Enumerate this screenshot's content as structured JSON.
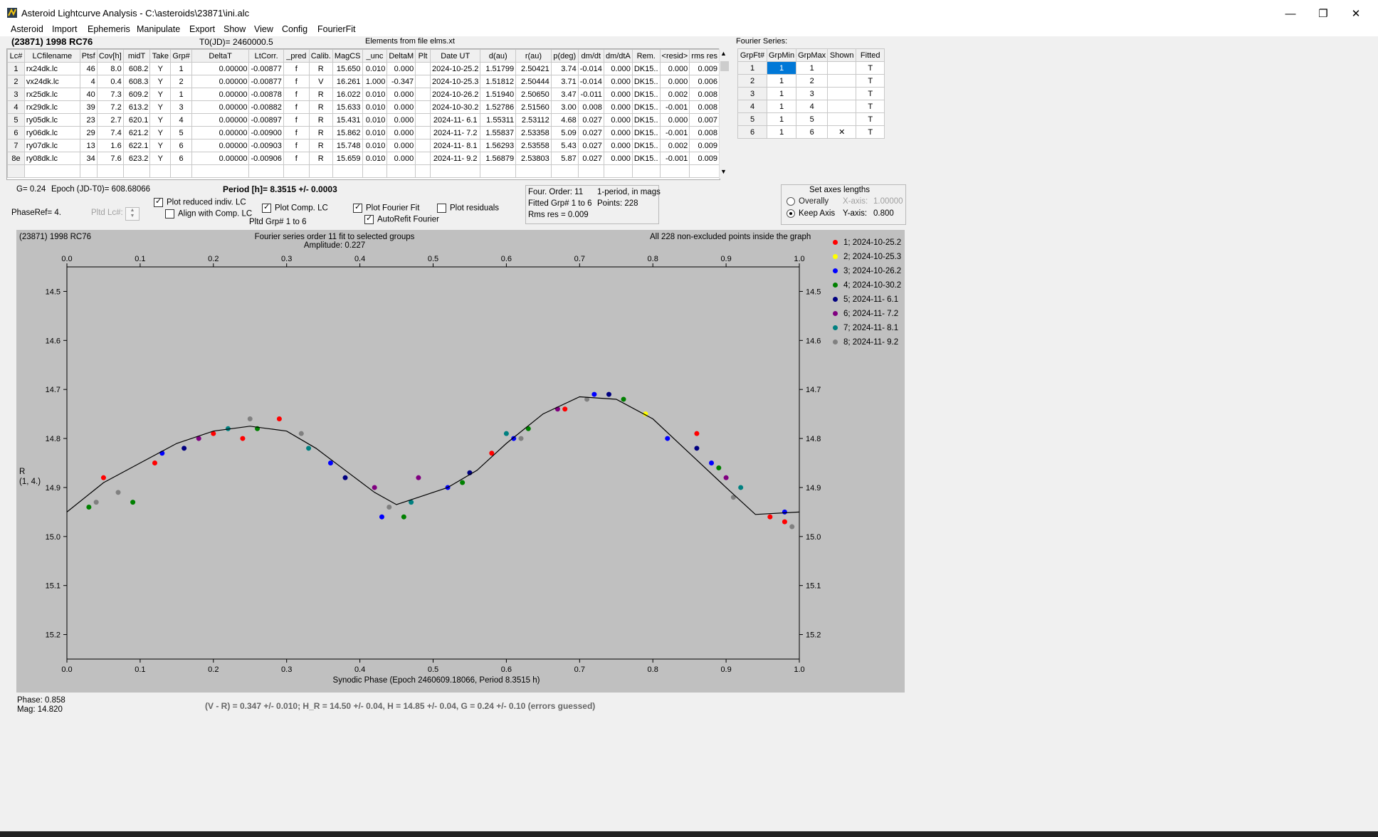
{
  "window": {
    "title": "Asteroid Lightcurve Analysis - C:\\asteroids\\23871\\ini.alc",
    "minimize": "—",
    "restore": "❐",
    "close": "✕"
  },
  "menu": [
    "Asteroid",
    "Import",
    "Ephemeris",
    "Manipulate",
    "Export",
    "Show",
    "View",
    "Config",
    "FourierFit"
  ],
  "header": {
    "asteroid_name": "(23871) 1998 RC76",
    "t0": "T0(JD)= 2460000.5",
    "elements_src": "Elements from file elms.xt",
    "fourier_series_label": "Fourier Series:"
  },
  "lc_table": {
    "columns": [
      "Lc#",
      "LCfilename",
      "Ptsf",
      "Cov[h]",
      "midT",
      "Take",
      "Grp#",
      "DeltaT",
      "LtCorr.",
      "_pred",
      "Calib.",
      "MagCS",
      "_unc",
      "DeltaM",
      "Plt",
      "Date UT",
      "d(au)",
      "r(au)",
      "p(deg)",
      "dm/dt",
      "dm/dtA",
      "Rem.",
      "<resid>",
      "rms res"
    ],
    "rows": [
      [
        "1",
        "rx24dk.lc",
        "46",
        "8.0",
        "608.2",
        "Y",
        "1",
        "0.00000",
        "-0.00877",
        "f",
        "R",
        "15.650",
        "0.010",
        "0.000",
        "",
        "2024-10-25.2",
        "1.51799",
        "2.50421",
        "3.74",
        "-0.014",
        "0.000",
        "DK15..",
        "0.000",
        "0.009"
      ],
      [
        "2",
        "vx24dk.lc",
        "4",
        "0.4",
        "608.3",
        "Y",
        "2",
        "0.00000",
        "-0.00877",
        "f",
        "V",
        "16.261",
        "1.000",
        "-0.347",
        "",
        "2024-10-25.3",
        "1.51812",
        "2.50444",
        "3.71",
        "-0.014",
        "0.000",
        "DK15..",
        "0.000",
        "0.006"
      ],
      [
        "3",
        "rx25dk.lc",
        "40",
        "7.3",
        "609.2",
        "Y",
        "1",
        "0.00000",
        "-0.00878",
        "f",
        "R",
        "16.022",
        "0.010",
        "0.000",
        "",
        "2024-10-26.2",
        "1.51940",
        "2.50650",
        "3.47",
        "-0.011",
        "0.000",
        "DK15..",
        "0.002",
        "0.008"
      ],
      [
        "4",
        "rx29dk.lc",
        "39",
        "7.2",
        "613.2",
        "Y",
        "3",
        "0.00000",
        "-0.00882",
        "f",
        "R",
        "15.633",
        "0.010",
        "0.000",
        "",
        "2024-10-30.2",
        "1.52786",
        "2.51560",
        "3.00",
        "0.008",
        "0.000",
        "DK15..",
        "-0.001",
        "0.008"
      ],
      [
        "5",
        "ry05dk.lc",
        "23",
        "2.7",
        "620.1",
        "Y",
        "4",
        "0.00000",
        "-0.00897",
        "f",
        "R",
        "15.431",
        "0.010",
        "0.000",
        "",
        "2024-11- 6.1",
        "1.55311",
        "2.53112",
        "4.68",
        "0.027",
        "0.000",
        "DK15..",
        "0.000",
        "0.007"
      ],
      [
        "6",
        "ry06dk.lc",
        "29",
        "7.4",
        "621.2",
        "Y",
        "5",
        "0.00000",
        "-0.00900",
        "f",
        "R",
        "15.862",
        "0.010",
        "0.000",
        "",
        "2024-11- 7.2",
        "1.55837",
        "2.53358",
        "5.09",
        "0.027",
        "0.000",
        "DK15..",
        "-0.001",
        "0.008"
      ],
      [
        "7",
        "ry07dk.lc",
        "13",
        "1.6",
        "622.1",
        "Y",
        "6",
        "0.00000",
        "-0.00903",
        "f",
        "R",
        "15.748",
        "0.010",
        "0.000",
        "",
        "2024-11- 8.1",
        "1.56293",
        "2.53558",
        "5.43",
        "0.027",
        "0.000",
        "DK15..",
        "0.002",
        "0.009"
      ],
      [
        "8e",
        "ry08dk.lc",
        "34",
        "7.6",
        "623.2",
        "Y",
        "6",
        "0.00000",
        "-0.00906",
        "f",
        "R",
        "15.659",
        "0.010",
        "0.000",
        "",
        "2024-11- 9.2",
        "1.56879",
        "2.53803",
        "5.87",
        "0.027",
        "0.000",
        "DK15..",
        "-0.001",
        "0.009"
      ]
    ]
  },
  "fourier_table": {
    "columns": [
      "GrpFt#",
      "GrpMin",
      "GrpMax",
      "Shown",
      "Fitted"
    ],
    "rows": [
      [
        "1",
        "1",
        "1",
        "",
        "T"
      ],
      [
        "2",
        "1",
        "2",
        "",
        "T"
      ],
      [
        "3",
        "1",
        "3",
        "",
        "T"
      ],
      [
        "4",
        "1",
        "4",
        "",
        "T"
      ],
      [
        "5",
        "1",
        "5",
        "",
        "T"
      ],
      [
        "6",
        "1",
        "6",
        "✕",
        "T"
      ]
    ]
  },
  "controls": {
    "g_value": "G= 0.24",
    "epoch": "Epoch (JD-T0)= 608.68066",
    "period": "Period [h]= 8.3515 +/- 0.0003",
    "phase_ref": "PhaseRef= 4.",
    "pltd_lc": "Pltd Lc#:",
    "plot_reduced": "Plot reduced indiv. LC",
    "align_comp": "Align with Comp. LC",
    "plot_comp": "Plot Comp. LC",
    "pltd_grp": "Pltd Grp#  1   to   6",
    "plot_fourier": "Plot Fourier Fit",
    "autorefit": "AutoRefit Fourier",
    "plot_residuals": "Plot residuals",
    "four_order": "Four. Order: 11",
    "one_period": "1-period, in mags",
    "fitted_grp": "Fitted Grp# 1 to 6",
    "points": "Points: 228",
    "rms_res": "Rms res      = 0.009",
    "set_axes": "Set axes lengths",
    "overally": "Overally",
    "keep_axis": "Keep Axis",
    "x_axis_label": "X-axis:",
    "x_axis_value": "1.00000",
    "y_axis_label": "Y-axis:",
    "y_axis_value": "0.800"
  },
  "footer": {
    "phase": "Phase:  0.858",
    "mag": "Mag:    14.820",
    "result": "(V - R) = 0.347 +/- 0.010; H_R = 14.50 +/- 0.04, H = 14.85 +/- 0.04, G = 0.24 +/- 0.10 (errors guessed)"
  },
  "chart_data": {
    "type": "scatter",
    "title_left": "(23871) 1998 RC76",
    "title_center": "Fourier series order 11 fit to selected groups",
    "amplitude": "Amplitude: 0.227",
    "title_right": "All 228 non-excluded points inside the graph",
    "xlabel": "Synodic Phase (Epoch 2460609.18066, Period 8.3515 h)",
    "ylabel": "R",
    "ylabel2": "(1, 4.)",
    "xlim": [
      0,
      1
    ],
    "ylim": [
      15.25,
      14.45
    ],
    "xticks": [
      "0.0",
      "0.1",
      "0.2",
      "0.3",
      "0.4",
      "0.5",
      "0.6",
      "0.7",
      "0.8",
      "0.9",
      "1.0"
    ],
    "yticks": [
      "14.5",
      "14.6",
      "14.7",
      "14.8",
      "14.9",
      "15.0",
      "15.1",
      "15.2"
    ],
    "fourier_curve": [
      [
        0.0,
        14.95
      ],
      [
        0.05,
        14.89
      ],
      [
        0.1,
        14.85
      ],
      [
        0.15,
        14.81
      ],
      [
        0.2,
        14.785
      ],
      [
        0.25,
        14.775
      ],
      [
        0.3,
        14.785
      ],
      [
        0.34,
        14.82
      ],
      [
        0.38,
        14.865
      ],
      [
        0.42,
        14.91
      ],
      [
        0.45,
        14.935
      ],
      [
        0.48,
        14.92
      ],
      [
        0.52,
        14.9
      ],
      [
        0.56,
        14.865
      ],
      [
        0.6,
        14.81
      ],
      [
        0.65,
        14.75
      ],
      [
        0.7,
        14.715
      ],
      [
        0.75,
        14.72
      ],
      [
        0.8,
        14.76
      ],
      [
        0.85,
        14.83
      ],
      [
        0.9,
        14.9
      ],
      [
        0.94,
        14.955
      ],
      [
        1.0,
        14.95
      ]
    ],
    "series": [
      {
        "name": "1; 2024-10-25.2",
        "color": "#ff0000",
        "points": [
          [
            0.05,
            14.88
          ],
          [
            0.12,
            14.85
          ],
          [
            0.2,
            14.79
          ],
          [
            0.24,
            14.8
          ],
          [
            0.29,
            14.76
          ],
          [
            0.58,
            14.83
          ],
          [
            0.68,
            14.74
          ],
          [
            0.86,
            14.79
          ],
          [
            0.96,
            14.96
          ],
          [
            0.98,
            14.97
          ]
        ]
      },
      {
        "name": "2; 2024-10-25.3",
        "color": "#ffff00",
        "points": [
          [
            0.79,
            14.75
          ]
        ]
      },
      {
        "name": "3; 2024-10-26.2",
        "color": "#0000ff",
        "points": [
          [
            0.13,
            14.83
          ],
          [
            0.36,
            14.85
          ],
          [
            0.43,
            14.96
          ],
          [
            0.52,
            14.9
          ],
          [
            0.61,
            14.8
          ],
          [
            0.72,
            14.71
          ],
          [
            0.82,
            14.8
          ],
          [
            0.88,
            14.85
          ],
          [
            0.98,
            14.95
          ]
        ]
      },
      {
        "name": "4; 2024-10-30.2",
        "color": "#008000",
        "points": [
          [
            0.03,
            14.94
          ],
          [
            0.09,
            14.93
          ],
          [
            0.26,
            14.78
          ],
          [
            0.46,
            14.96
          ],
          [
            0.54,
            14.89
          ],
          [
            0.63,
            14.78
          ],
          [
            0.76,
            14.72
          ],
          [
            0.89,
            14.86
          ]
        ]
      },
      {
        "name": "5; 2024-11- 6.1",
        "color": "#000080",
        "points": [
          [
            0.16,
            14.82
          ],
          [
            0.38,
            14.88
          ],
          [
            0.55,
            14.87
          ],
          [
            0.74,
            14.71
          ],
          [
            0.86,
            14.82
          ]
        ]
      },
      {
        "name": "6; 2024-11- 7.2",
        "color": "#800080",
        "points": [
          [
            0.18,
            14.8
          ],
          [
            0.42,
            14.9
          ],
          [
            0.48,
            14.88
          ],
          [
            0.67,
            14.74
          ],
          [
            0.9,
            14.88
          ]
        ]
      },
      {
        "name": "7; 2024-11- 8.1",
        "color": "#008080",
        "points": [
          [
            0.22,
            14.78
          ],
          [
            0.33,
            14.82
          ],
          [
            0.47,
            14.93
          ],
          [
            0.6,
            14.79
          ],
          [
            0.92,
            14.9
          ]
        ]
      },
      {
        "name": "8; 2024-11- 9.2",
        "color": "#808080",
        "points": [
          [
            0.04,
            14.93
          ],
          [
            0.07,
            14.91
          ],
          [
            0.25,
            14.76
          ],
          [
            0.32,
            14.79
          ],
          [
            0.44,
            14.94
          ],
          [
            0.62,
            14.8
          ],
          [
            0.71,
            14.72
          ],
          [
            0.91,
            14.92
          ],
          [
            0.99,
            14.98
          ]
        ]
      }
    ]
  }
}
